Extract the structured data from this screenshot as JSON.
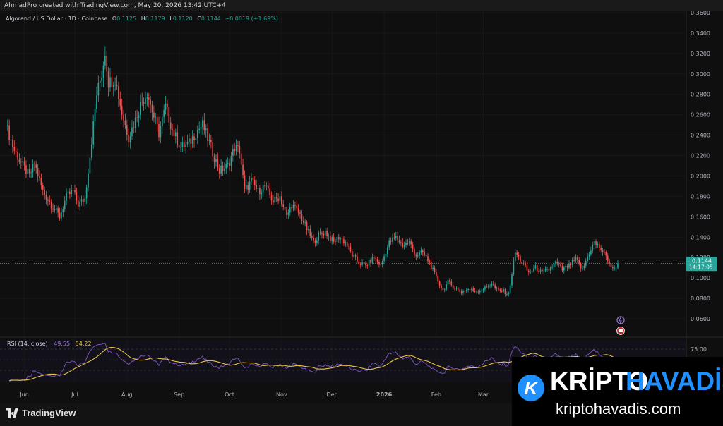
{
  "header": {
    "credit": "AhmadPro created with TradingView.com, May 20, 2026 13:42 UTC+4"
  },
  "legend": {
    "symbol": "Algorand / US Dollar · 1D · Coinbase",
    "open_label": "O",
    "open": "0.1125",
    "high_label": "H",
    "high": "0.1179",
    "low_label": "L",
    "low": "0.1120",
    "close_label": "C",
    "close": "0.1144",
    "change": "+0.0019 (+1.69%)"
  },
  "price_tag": {
    "price": "0.1144",
    "countdown": "14:17:05"
  },
  "rsi": {
    "label": "RSI (14, close)",
    "value": "49.55",
    "ma_value": "54.22",
    "upper_level": "75.00"
  },
  "footer": {
    "brand": "TradingView"
  },
  "banner": {
    "word1": "KRİPTO",
    "word2": "HAVADİS",
    "site": "kriptohavadis.com",
    "logo_letter": "K"
  },
  "colors": {
    "up": "#26a69a",
    "down": "#ef5350",
    "rsi": "#7e57c2",
    "rsi_ma": "#e8c547",
    "banner_blue": "#1e90ff",
    "background": "#0f0f0f"
  },
  "chart_data": {
    "type": "candlestick",
    "title": "Algorand / US Dollar · 1D · Coinbase",
    "x_ticks": [
      "Jun",
      "Jul",
      "Aug",
      "Sep",
      "Oct",
      "Nov",
      "Dec",
      "2026",
      "Feb",
      "Mar"
    ],
    "y_ticks": [
      "0.3600",
      "0.3400",
      "0.3200",
      "0.3000",
      "0.2800",
      "0.2600",
      "0.2400",
      "0.2200",
      "0.2000",
      "0.1800",
      "0.1600",
      "0.1400",
      "0.1200",
      "0.1000",
      "0.0800",
      "0.0600"
    ],
    "ylim": [
      0.055,
      0.365
    ],
    "price_path": [
      [
        "2025-05-22",
        0.245
      ],
      [
        "2025-05-26",
        0.225
      ],
      [
        "2025-05-31",
        0.21
      ],
      [
        "2025-06-04",
        0.2
      ],
      [
        "2025-06-07",
        0.212
      ],
      [
        "2025-06-12",
        0.185
      ],
      [
        "2025-06-17",
        0.172
      ],
      [
        "2025-06-22",
        0.16
      ],
      [
        "2025-06-26",
        0.18
      ],
      [
        "2025-06-30",
        0.185
      ],
      [
        "2025-07-03",
        0.172
      ],
      [
        "2025-07-07",
        0.178
      ],
      [
        "2025-07-10",
        0.22
      ],
      [
        "2025-07-14",
        0.28
      ],
      [
        "2025-07-17",
        0.3
      ],
      [
        "2025-07-19",
        0.322
      ],
      [
        "2025-07-21",
        0.292
      ],
      [
        "2025-07-25",
        0.295
      ],
      [
        "2025-07-29",
        0.262
      ],
      [
        "2025-08-02",
        0.238
      ],
      [
        "2025-08-06",
        0.255
      ],
      [
        "2025-08-09",
        0.27
      ],
      [
        "2025-08-13",
        0.282
      ],
      [
        "2025-08-17",
        0.258
      ],
      [
        "2025-08-20",
        0.242
      ],
      [
        "2025-08-24",
        0.268
      ],
      [
        "2025-08-28",
        0.245
      ],
      [
        "2025-09-02",
        0.228
      ],
      [
        "2025-09-07",
        0.232
      ],
      [
        "2025-09-12",
        0.245
      ],
      [
        "2025-09-15",
        0.25
      ],
      [
        "2025-09-20",
        0.228
      ],
      [
        "2025-09-25",
        0.205
      ],
      [
        "2025-09-30",
        0.21
      ],
      [
        "2025-10-04",
        0.228
      ],
      [
        "2025-10-07",
        0.225
      ],
      [
        "2025-10-10",
        0.185
      ],
      [
        "2025-10-14",
        0.195
      ],
      [
        "2025-10-18",
        0.185
      ],
      [
        "2025-10-22",
        0.19
      ],
      [
        "2025-10-27",
        0.175
      ],
      [
        "2025-10-31",
        0.18
      ],
      [
        "2025-11-04",
        0.16
      ],
      [
        "2025-11-07",
        0.172
      ],
      [
        "2025-11-12",
        0.162
      ],
      [
        "2025-11-16",
        0.148
      ],
      [
        "2025-11-20",
        0.135
      ],
      [
        "2025-11-23",
        0.142
      ],
      [
        "2025-11-27",
        0.145
      ],
      [
        "2025-12-02",
        0.135
      ],
      [
        "2025-12-05",
        0.14
      ],
      [
        "2025-12-09",
        0.135
      ],
      [
        "2025-12-13",
        0.122
      ],
      [
        "2025-12-17",
        0.115
      ],
      [
        "2025-12-21",
        0.112
      ],
      [
        "2025-12-26",
        0.12
      ],
      [
        "2025-12-30",
        0.112
      ],
      [
        "2026-01-04",
        0.135
      ],
      [
        "2026-01-08",
        0.14
      ],
      [
        "2026-01-12",
        0.132
      ],
      [
        "2026-01-16",
        0.135
      ],
      [
        "2026-01-20",
        0.122
      ],
      [
        "2026-01-24",
        0.125
      ],
      [
        "2026-01-28",
        0.115
      ],
      [
        "2026-02-01",
        0.1
      ],
      [
        "2026-02-05",
        0.088
      ],
      [
        "2026-02-08",
        0.096
      ],
      [
        "2026-02-12",
        0.09
      ],
      [
        "2026-02-16",
        0.086
      ],
      [
        "2026-02-20",
        0.089
      ],
      [
        "2026-02-25",
        0.087
      ],
      [
        "2026-03-02",
        0.09
      ],
      [
        "2026-03-06",
        0.095
      ],
      [
        "2026-03-09",
        0.088
      ],
      [
        "2026-03-13",
        0.087
      ],
      [
        "2026-03-16",
        0.084
      ],
      [
        "2026-03-20",
        0.125
      ],
      [
        "2026-03-24",
        0.115
      ],
      [
        "2026-03-28",
        0.105
      ],
      [
        "2026-04-01",
        0.11
      ],
      [
        "2026-04-05",
        0.105
      ],
      [
        "2026-04-09",
        0.108
      ],
      [
        "2026-04-13",
        0.115
      ],
      [
        "2026-04-17",
        0.108
      ],
      [
        "2026-04-21",
        0.112
      ],
      [
        "2026-04-25",
        0.118
      ],
      [
        "2026-04-29",
        0.108
      ],
      [
        "2026-05-03",
        0.125
      ],
      [
        "2026-05-06",
        0.135
      ],
      [
        "2026-05-10",
        0.128
      ],
      [
        "2026-05-14",
        0.118
      ],
      [
        "2026-05-17",
        0.108
      ],
      [
        "2026-05-19",
        0.112
      ],
      [
        "2026-05-20",
        0.1144
      ]
    ],
    "last_price": 0.1144,
    "rsi_series": {
      "name": "RSI (14, close)",
      "last": 49.55
    },
    "rsi_ma_series": {
      "last": 54.22
    },
    "rsi_levels": [
      75.0
    ]
  }
}
